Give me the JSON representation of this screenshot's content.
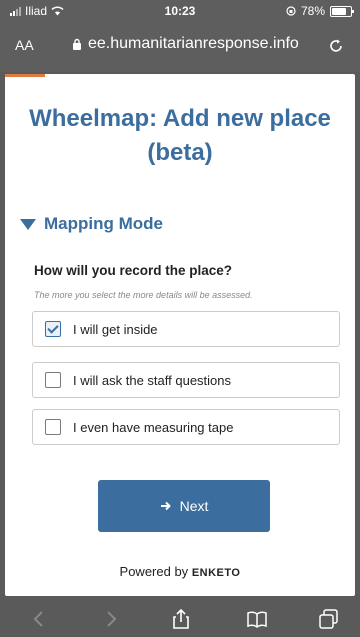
{
  "status": {
    "carrier": "Iliad",
    "time": "10:23",
    "battery": "78%",
    "battery_level": 0.78
  },
  "browser": {
    "text_size_label": "AA",
    "url": "ee.humanitarianresponse.info"
  },
  "form": {
    "title": "Wheelmap: Add new place (beta)",
    "group_label": "Mapping Mode",
    "question": "How will you record the place?",
    "hint": "The more you select the more details will be assessed.",
    "options": [
      {
        "label": "I will get inside",
        "checked": true
      },
      {
        "label": "I will ask the staff questions",
        "checked": false
      },
      {
        "label": "I even have measuring tape",
        "checked": false
      }
    ],
    "next_label": "Next",
    "powered_prefix": "Powered by",
    "powered_brand": "ENKETO"
  },
  "toolbar": {
    "icons": [
      "back-icon",
      "forward-icon",
      "share-icon",
      "bookmarks-icon",
      "tabs-icon"
    ]
  },
  "colors": {
    "accent": "#3b6e9e",
    "chrome": "#5e5e5e",
    "underline": "#e07a3e"
  }
}
